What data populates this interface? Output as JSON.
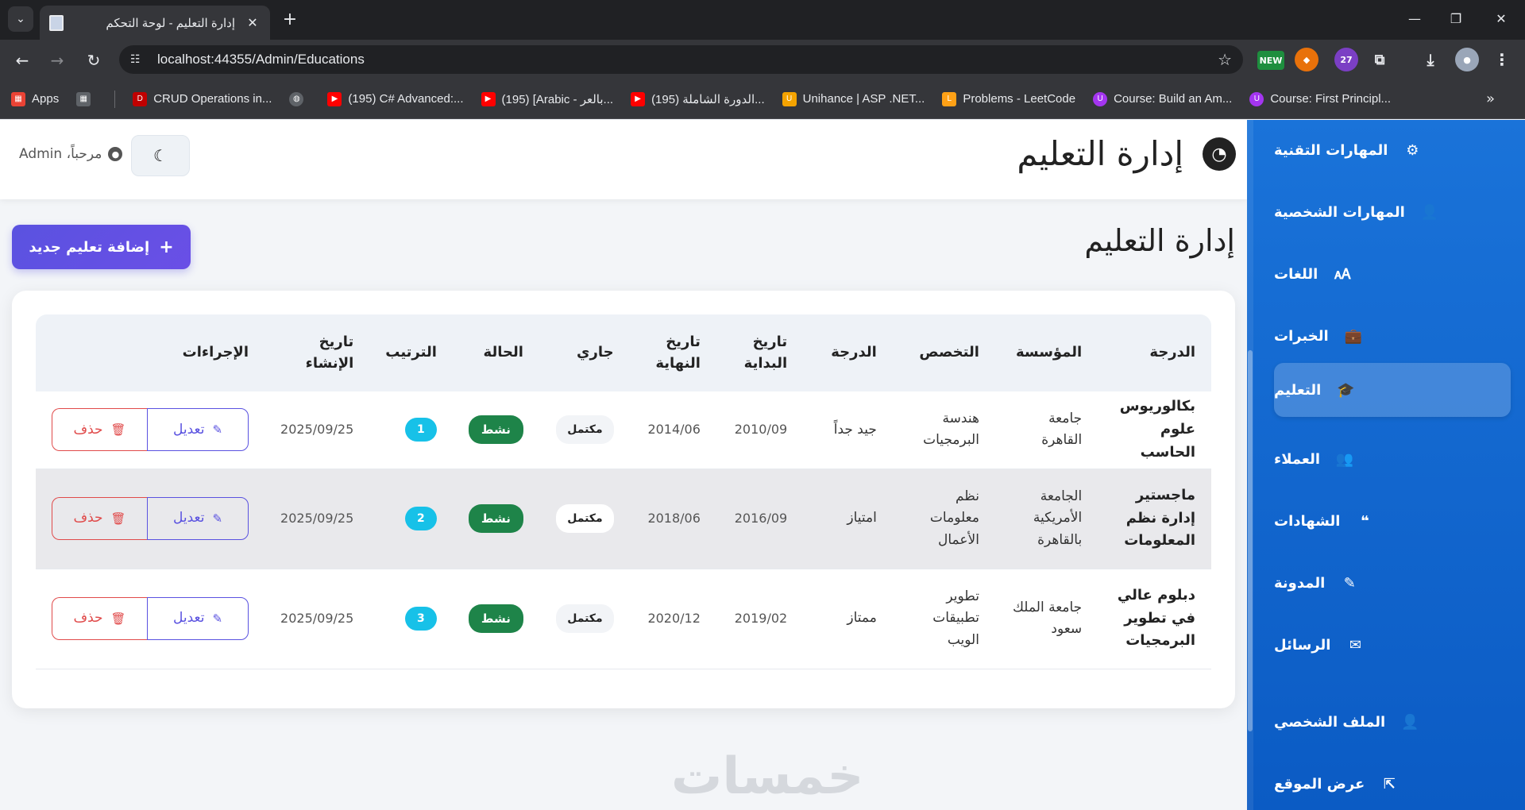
{
  "browser": {
    "tab_title": "إدارة التعليم - لوحة التحكم",
    "url": "localhost:44355/Admin/Educations",
    "extension_badge": "27",
    "new_badge": "NEW",
    "bookmarks": [
      {
        "label": "Apps",
        "icon": "apps-grid-icon",
        "color": "#ea4335"
      },
      {
        "label": "",
        "icon": "grid-icon",
        "color": "#5f6368"
      },
      {
        "label": "CRUD Operations in...",
        "icon": "d-logo-icon",
        "color": "#c00000"
      },
      {
        "label": "",
        "icon": "globe-icon",
        "color": "#5f6368"
      },
      {
        "label": "(195) C# Advanced:...",
        "icon": "youtube-icon",
        "color": "#ff0000"
      },
      {
        "label": "(195) [Arabic - بالعر...",
        "icon": "youtube-icon",
        "color": "#ff0000"
      },
      {
        "label": "(195) الدورة الشاملة...",
        "icon": "youtube-icon",
        "color": "#ff0000"
      },
      {
        "label": "Unihance | ASP .NET...",
        "icon": "unihance-icon",
        "color": "#f4a300"
      },
      {
        "label": "Problems - LeetCode",
        "icon": "leetcode-icon",
        "color": "#ffa116"
      },
      {
        "label": "Course: Build an Am...",
        "icon": "udemy-icon",
        "color": "#a435f0"
      },
      {
        "label": "Course: First Principl...",
        "icon": "udemy-icon",
        "color": "#a435f0"
      }
    ]
  },
  "header": {
    "title": "إدارة التعليم",
    "welcome": "مرحباً، Admin",
    "theme_icon": "moon-icon"
  },
  "main": {
    "page_title": "إدارة التعليم",
    "add_button": "إضافة تعليم جديد"
  },
  "table": {
    "columns": [
      "الدرجة",
      "المؤسسة",
      "التخصص",
      "الدرجة",
      "تاريخ البداية",
      "تاريخ النهاية",
      "جاري",
      "الحالة",
      "الترتيب",
      "تاريخ الإنشاء",
      "الإجراءات"
    ],
    "rows": [
      {
        "degree": "بكالوريوس علوم الحاسب",
        "institution": "جامعة القاهرة",
        "major": "هندسة البرمجيات",
        "grade": "جيد جداً",
        "start": "2010/09",
        "end": "2014/06",
        "ongoing": "مكتمل",
        "status": "نشط",
        "order": "1",
        "created": "2025/09/25",
        "edit": "تعديل",
        "delete": "حذف"
      },
      {
        "degree": "ماجستير إدارة نظم المعلومات",
        "institution": "الجامعة الأمريكية بالقاهرة",
        "major": "نظم معلومات الأعمال",
        "grade": "امتياز",
        "start": "2016/09",
        "end": "2018/06",
        "ongoing": "مكتمل",
        "status": "نشط",
        "order": "2",
        "created": "2025/09/25",
        "edit": "تعديل",
        "delete": "حذف"
      },
      {
        "degree": "دبلوم عالي في تطوير البرمجيات",
        "institution": "جامعة الملك سعود",
        "major": "تطوير تطبيقات الويب",
        "grade": "ممتاز",
        "start": "2019/02",
        "end": "2020/12",
        "ongoing": "مكتمل",
        "status": "نشط",
        "order": "3",
        "created": "2025/09/25",
        "edit": "تعديل",
        "delete": "حذف"
      }
    ]
  },
  "sidebar": {
    "items": [
      {
        "label": "المهارات التقنية",
        "icon": "gears-icon"
      },
      {
        "label": "المهارات الشخصية",
        "icon": "user-icon"
      },
      {
        "label": "اللغات",
        "icon": "language-icon"
      },
      {
        "label": "الخبرات",
        "icon": "briefcase-icon"
      },
      {
        "label": "التعليم",
        "icon": "graduation-cap-icon",
        "active": true
      },
      {
        "label": "العملاء",
        "icon": "users-icon"
      },
      {
        "label": "الشهادات",
        "icon": "quote-icon"
      },
      {
        "label": "المدونة",
        "icon": "blog-icon"
      },
      {
        "label": "الرسائل",
        "icon": "envelope-icon"
      },
      {
        "label": "الملف الشخصي",
        "icon": "user-gear-icon"
      },
      {
        "label": "عرض الموقع",
        "icon": "external-link-icon"
      }
    ]
  },
  "watermark": "خمسات",
  "colors": {
    "sidebar": "#1a73d9",
    "primary": "#5a52e0",
    "danger": "#e04a4a",
    "success": "#1e8449",
    "info": "#17c1e8"
  }
}
